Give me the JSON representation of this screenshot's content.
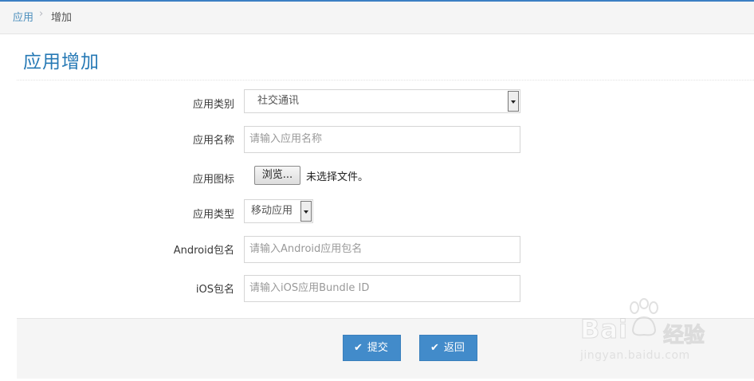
{
  "breadcrumb": {
    "link": "应用",
    "separator": "›",
    "current": "增加"
  },
  "page_title": "应用增加",
  "form": {
    "category": {
      "label": "应用类别",
      "value": "社交通讯"
    },
    "name": {
      "label": "应用名称",
      "placeholder": "请输入应用名称"
    },
    "icon": {
      "label": "应用图标",
      "button": "浏览...",
      "status": "未选择文件。"
    },
    "type": {
      "label": "应用类型",
      "value": "移动应用"
    },
    "android_package": {
      "label": "Android包名",
      "placeholder": "请输入Android应用包名"
    },
    "ios_package": {
      "label": "iOS包名",
      "placeholder": "请输入iOS应用Bundle ID"
    }
  },
  "actions": {
    "submit": "提交",
    "back": "返回",
    "icon": "check-icon"
  },
  "watermark": {
    "brand": "Bai",
    "sub": "经验",
    "url": "jingyan.baidu.com"
  },
  "colors": {
    "accent": "#428bca",
    "title": "#2679b5",
    "link": "#4c8fbd"
  }
}
